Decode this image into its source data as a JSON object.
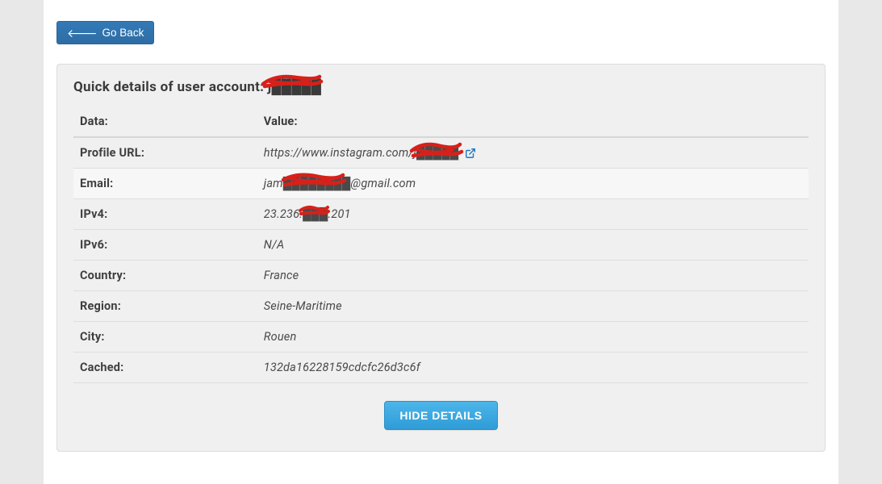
{
  "buttons": {
    "go_back": "Go Back",
    "hide_details": "HIDE DETAILS"
  },
  "panel": {
    "title_prefix": "Quick details of user account:",
    "title_username_redacted": "j█████"
  },
  "table": {
    "col_data": "Data:",
    "col_value": "Value:"
  },
  "rows": {
    "profile_url": {
      "label": "Profile URL:",
      "value_prefix": "https://www.instagram.com/",
      "value_username_redacted": "j█████"
    },
    "email": {
      "label": "Email:",
      "value_prefix": "jam",
      "value_middle_redacted": "████████",
      "value_suffix": "@gmail.com"
    },
    "ipv4": {
      "label": "IPv4:",
      "value_prefix": "23.236.",
      "value_middle_redacted": "███",
      "value_suffix": ".201"
    },
    "ipv6": {
      "label": "IPv6:",
      "value": "N/A"
    },
    "country": {
      "label": "Country:",
      "value": "France"
    },
    "region": {
      "label": "Region:",
      "value": "Seine-Maritime"
    },
    "city": {
      "label": "City:",
      "value": "Rouen"
    },
    "cached": {
      "label": "Cached:",
      "value": "132da16228159cdcfc26d3c6f"
    }
  }
}
